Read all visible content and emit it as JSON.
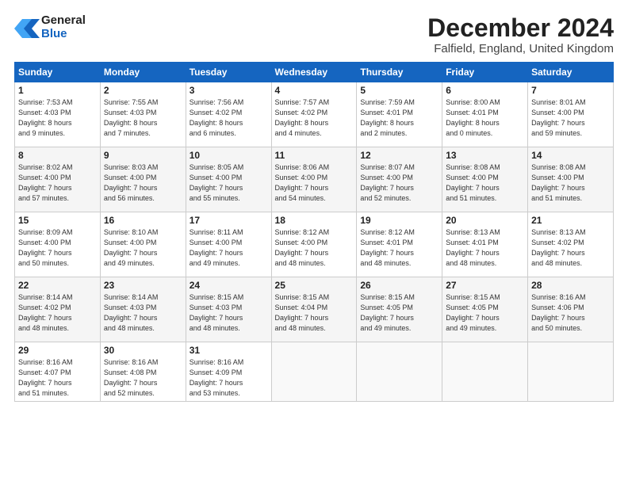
{
  "header": {
    "logo_general": "General",
    "logo_blue": "Blue",
    "month_title": "December 2024",
    "location": "Falfield, England, United Kingdom"
  },
  "days_of_week": [
    "Sunday",
    "Monday",
    "Tuesday",
    "Wednesday",
    "Thursday",
    "Friday",
    "Saturday"
  ],
  "weeks": [
    [
      {
        "day": "1",
        "sunrise": "7:53 AM",
        "sunset": "4:03 PM",
        "daylight": "8 hours and 9 minutes."
      },
      {
        "day": "2",
        "sunrise": "7:55 AM",
        "sunset": "4:03 PM",
        "daylight": "8 hours and 7 minutes."
      },
      {
        "day": "3",
        "sunrise": "7:56 AM",
        "sunset": "4:02 PM",
        "daylight": "8 hours and 6 minutes."
      },
      {
        "day": "4",
        "sunrise": "7:57 AM",
        "sunset": "4:02 PM",
        "daylight": "8 hours and 4 minutes."
      },
      {
        "day": "5",
        "sunrise": "7:59 AM",
        "sunset": "4:01 PM",
        "daylight": "8 hours and 2 minutes."
      },
      {
        "day": "6",
        "sunrise": "8:00 AM",
        "sunset": "4:01 PM",
        "daylight": "8 hours and 0 minutes."
      },
      {
        "day": "7",
        "sunrise": "8:01 AM",
        "sunset": "4:00 PM",
        "daylight": "7 hours and 59 minutes."
      }
    ],
    [
      {
        "day": "8",
        "sunrise": "8:02 AM",
        "sunset": "4:00 PM",
        "daylight": "7 hours and 57 minutes."
      },
      {
        "day": "9",
        "sunrise": "8:03 AM",
        "sunset": "4:00 PM",
        "daylight": "7 hours and 56 minutes."
      },
      {
        "day": "10",
        "sunrise": "8:05 AM",
        "sunset": "4:00 PM",
        "daylight": "7 hours and 55 minutes."
      },
      {
        "day": "11",
        "sunrise": "8:06 AM",
        "sunset": "4:00 PM",
        "daylight": "7 hours and 54 minutes."
      },
      {
        "day": "12",
        "sunrise": "8:07 AM",
        "sunset": "4:00 PM",
        "daylight": "7 hours and 52 minutes."
      },
      {
        "day": "13",
        "sunrise": "8:08 AM",
        "sunset": "4:00 PM",
        "daylight": "7 hours and 51 minutes."
      },
      {
        "day": "14",
        "sunrise": "8:08 AM",
        "sunset": "4:00 PM",
        "daylight": "7 hours and 51 minutes."
      }
    ],
    [
      {
        "day": "15",
        "sunrise": "8:09 AM",
        "sunset": "4:00 PM",
        "daylight": "7 hours and 50 minutes."
      },
      {
        "day": "16",
        "sunrise": "8:10 AM",
        "sunset": "4:00 PM",
        "daylight": "7 hours and 49 minutes."
      },
      {
        "day": "17",
        "sunrise": "8:11 AM",
        "sunset": "4:00 PM",
        "daylight": "7 hours and 49 minutes."
      },
      {
        "day": "18",
        "sunrise": "8:12 AM",
        "sunset": "4:00 PM",
        "daylight": "7 hours and 48 minutes."
      },
      {
        "day": "19",
        "sunrise": "8:12 AM",
        "sunset": "4:01 PM",
        "daylight": "7 hours and 48 minutes."
      },
      {
        "day": "20",
        "sunrise": "8:13 AM",
        "sunset": "4:01 PM",
        "daylight": "7 hours and 48 minutes."
      },
      {
        "day": "21",
        "sunrise": "8:13 AM",
        "sunset": "4:02 PM",
        "daylight": "7 hours and 48 minutes."
      }
    ],
    [
      {
        "day": "22",
        "sunrise": "8:14 AM",
        "sunset": "4:02 PM",
        "daylight": "7 hours and 48 minutes."
      },
      {
        "day": "23",
        "sunrise": "8:14 AM",
        "sunset": "4:03 PM",
        "daylight": "7 hours and 48 minutes."
      },
      {
        "day": "24",
        "sunrise": "8:15 AM",
        "sunset": "4:03 PM",
        "daylight": "7 hours and 48 minutes."
      },
      {
        "day": "25",
        "sunrise": "8:15 AM",
        "sunset": "4:04 PM",
        "daylight": "7 hours and 48 minutes."
      },
      {
        "day": "26",
        "sunrise": "8:15 AM",
        "sunset": "4:05 PM",
        "daylight": "7 hours and 49 minutes."
      },
      {
        "day": "27",
        "sunrise": "8:15 AM",
        "sunset": "4:05 PM",
        "daylight": "7 hours and 49 minutes."
      },
      {
        "day": "28",
        "sunrise": "8:16 AM",
        "sunset": "4:06 PM",
        "daylight": "7 hours and 50 minutes."
      }
    ],
    [
      {
        "day": "29",
        "sunrise": "8:16 AM",
        "sunset": "4:07 PM",
        "daylight": "7 hours and 51 minutes."
      },
      {
        "day": "30",
        "sunrise": "8:16 AM",
        "sunset": "4:08 PM",
        "daylight": "7 hours and 52 minutes."
      },
      {
        "day": "31",
        "sunrise": "8:16 AM",
        "sunset": "4:09 PM",
        "daylight": "7 hours and 53 minutes."
      },
      null,
      null,
      null,
      null
    ]
  ]
}
